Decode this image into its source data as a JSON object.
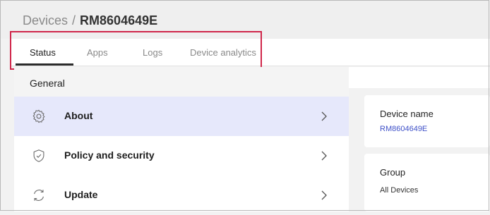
{
  "breadcrumb": {
    "parent": "Devices",
    "separator": "/",
    "current": "RM8604649E"
  },
  "tabs": [
    {
      "label": "Status",
      "active": true
    },
    {
      "label": "Apps",
      "active": false
    },
    {
      "label": "Logs",
      "active": false
    },
    {
      "label": "Device analytics",
      "active": false
    }
  ],
  "left": {
    "section_title": "General",
    "items": [
      {
        "label": "About",
        "icon": "gear-icon",
        "selected": true
      },
      {
        "label": "Policy and security",
        "icon": "shield-check-icon",
        "selected": false
      },
      {
        "label": "Update",
        "icon": "refresh-icon",
        "selected": false
      }
    ]
  },
  "right": {
    "device_name_title": "Device name",
    "device_name_value": "RM8604649E",
    "group_title": "Group",
    "group_value": "All Devices"
  },
  "colors": {
    "highlight": "#d0264a",
    "selected_bg": "#e6e8fb",
    "link": "#3f51c8"
  }
}
